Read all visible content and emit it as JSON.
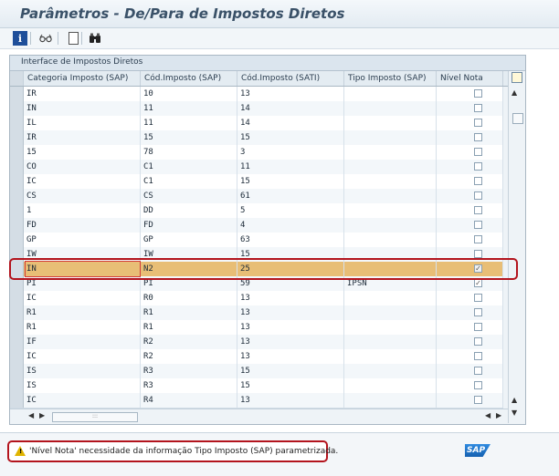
{
  "window": {
    "title": "Parâmetros - De/Para de Impostos Diretos"
  },
  "toolbar": {
    "info_icon": "i",
    "glasses_icon": "glasses-icon",
    "new_icon": "new-document-icon",
    "find_icon": "binoculars-icon"
  },
  "grid": {
    "title": "Interface de Impostos Diretos",
    "columns": [
      "Categoria Imposto (SAP)",
      "Cód.Imposto (SAP)",
      "Cód.Imposto (SATI)",
      "Tipo Imposto (SAP)",
      "Nível Nota"
    ],
    "rows": [
      {
        "cat": "IR",
        "sap": "10",
        "sati": "13",
        "tipo": "",
        "nivel": false
      },
      {
        "cat": "IN",
        "sap": "11",
        "sati": "14",
        "tipo": "",
        "nivel": false
      },
      {
        "cat": "IL",
        "sap": "11",
        "sati": "14",
        "tipo": "",
        "nivel": false
      },
      {
        "cat": "IR",
        "sap": "15",
        "sati": "15",
        "tipo": "",
        "nivel": false
      },
      {
        "cat": "15",
        "sap": "78",
        "sati": "3",
        "tipo": "",
        "nivel": false
      },
      {
        "cat": "CO",
        "sap": "C1",
        "sati": "11",
        "tipo": "",
        "nivel": false
      },
      {
        "cat": "IC",
        "sap": "C1",
        "sati": "15",
        "tipo": "",
        "nivel": false
      },
      {
        "cat": "CS",
        "sap": "CS",
        "sati": "61",
        "tipo": "",
        "nivel": false
      },
      {
        "cat": "1",
        "sap": "DD",
        "sati": "5",
        "tipo": "",
        "nivel": false
      },
      {
        "cat": "FD",
        "sap": "FD",
        "sati": "4",
        "tipo": "",
        "nivel": false
      },
      {
        "cat": "GP",
        "sap": "GP",
        "sati": "63",
        "tipo": "",
        "nivel": false
      },
      {
        "cat": "IW",
        "sap": "IW",
        "sati": "15",
        "tipo": "",
        "nivel": false
      },
      {
        "cat": "IN",
        "sap": "N2",
        "sati": "25",
        "tipo": "",
        "nivel": true
      },
      {
        "cat": "PI",
        "sap": "PI",
        "sati": "59",
        "tipo": "IPSN",
        "nivel": true
      },
      {
        "cat": "IC",
        "sap": "R0",
        "sati": "13",
        "tipo": "",
        "nivel": false
      },
      {
        "cat": "R1",
        "sap": "R1",
        "sati": "13",
        "tipo": "",
        "nivel": false
      },
      {
        "cat": "R1",
        "sap": "R1",
        "sati": "13",
        "tipo": "",
        "nivel": false
      },
      {
        "cat": "IF",
        "sap": "R2",
        "sati": "13",
        "tipo": "",
        "nivel": false
      },
      {
        "cat": "IC",
        "sap": "R2",
        "sati": "13",
        "tipo": "",
        "nivel": false
      },
      {
        "cat": "IS",
        "sap": "R3",
        "sati": "15",
        "tipo": "",
        "nivel": false
      },
      {
        "cat": "IS",
        "sap": "R3",
        "sati": "15",
        "tipo": "",
        "nivel": false
      },
      {
        "cat": "IC",
        "sap": "R4",
        "sati": "13",
        "tipo": "",
        "nivel": false
      }
    ],
    "selected_row": 12
  },
  "status": {
    "message": "'Nível Nota' necessidade da informação Tipo Imposto (SAP) parametrizada.",
    "logo": "SAP"
  }
}
